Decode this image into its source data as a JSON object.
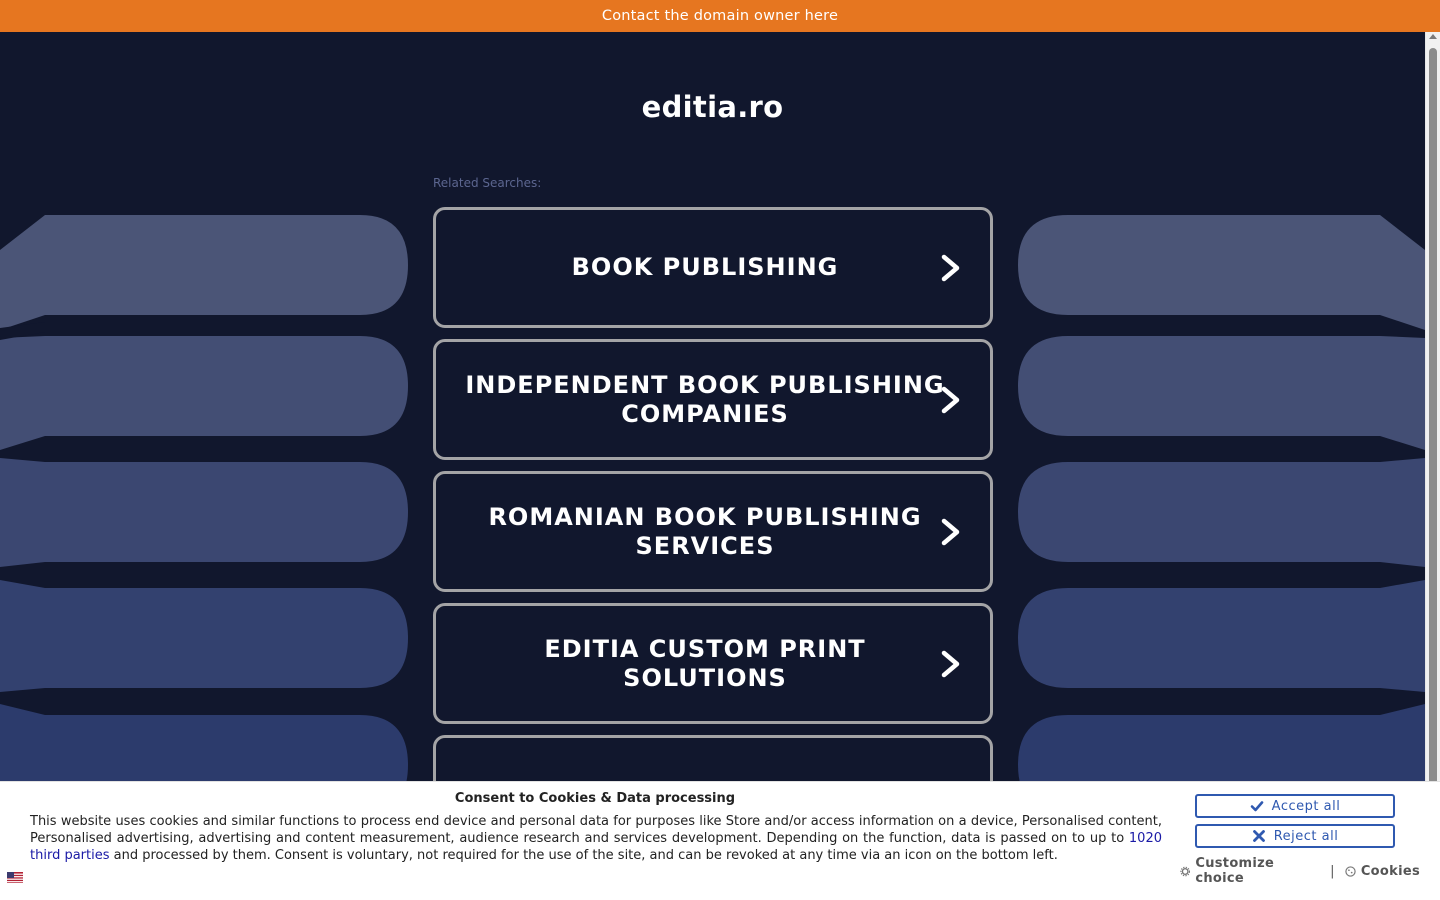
{
  "topbar": {
    "contact_link": "Contact the domain owner here",
    "color": "#e67620"
  },
  "header": {
    "domain": "editia.ro"
  },
  "related": {
    "label": "Related Searches:",
    "items": [
      {
        "label": "BOOK PUBLISHING"
      },
      {
        "label": "INDEPENDENT BOOK PUBLISHING COMPANIES"
      },
      {
        "label": "ROMANIAN BOOK PUBLISHING SERVICES"
      },
      {
        "label": "EDITIA CUSTOM PRINT SOLUTIONS"
      },
      {
        "label": ""
      }
    ]
  },
  "consent": {
    "title": "Consent to Cookies & Data processing",
    "text_part1": "This website uses cookies and similar functions to process end device and personal data for purposes like Store and/or access information on a device, Personalised content, Personalised advertising, advertising and content measurement, audience research and services development. Depending on the function, data is passed on to up to ",
    "third_parties_link": "1020 third parties",
    "text_part2": " and processed by them. Consent is voluntary, not required for the use of the site, and can be revoked at any time via an icon on the bottom left.",
    "accept_label": "Accept all",
    "reject_label": "Reject all",
    "customize_label": "Customize choice",
    "separator": "|",
    "cookies_label": "Cookies",
    "accent_color": "#2f59b0"
  },
  "colors": {
    "background": "#11172d",
    "card_border": "#a4a4a6"
  },
  "icons": {
    "chevron": "chevron-right-icon",
    "accept": "check-icon",
    "reject": "x-icon",
    "customize": "gear-icon",
    "cookies": "cookie-icon",
    "language": "us-flag-icon"
  }
}
